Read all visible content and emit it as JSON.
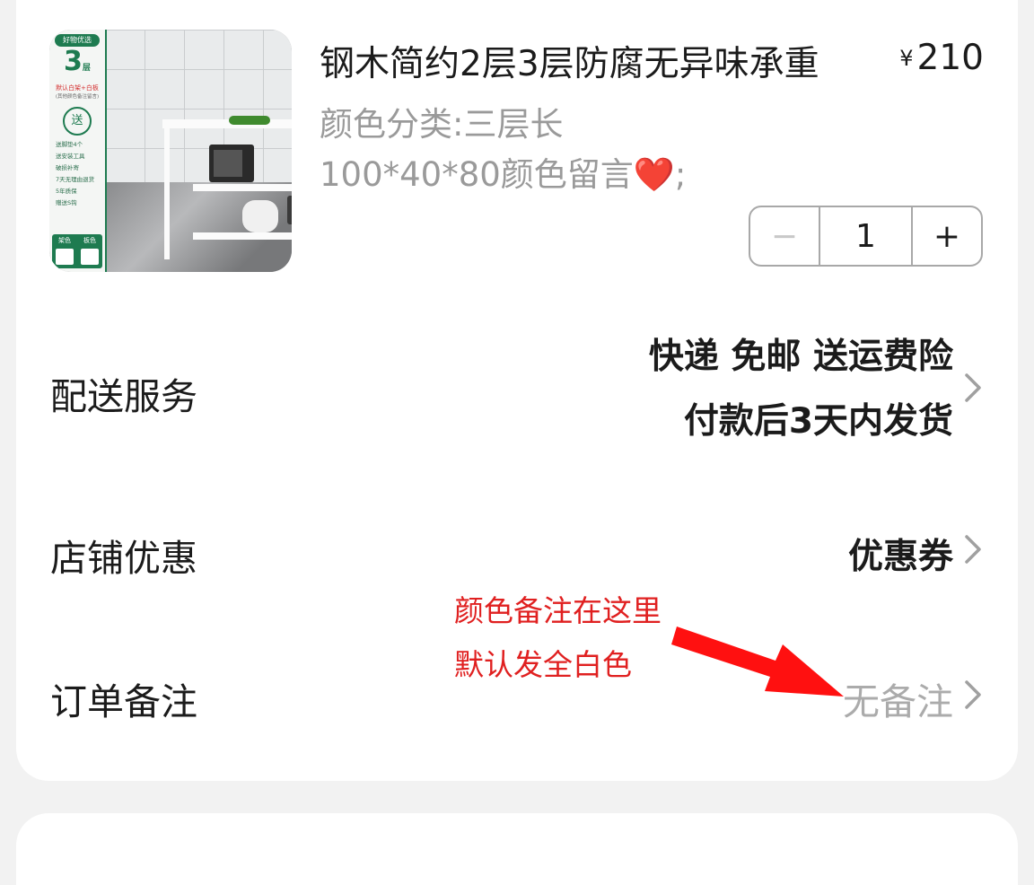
{
  "product": {
    "title": "钢木简约2层3层防腐无异味承重",
    "price_symbol": "¥",
    "price": "210",
    "spec_line1": "颜色分类:三层长",
    "spec_line2_text": "100*40*80颜色留言",
    "spec_line2_heart": "❤️",
    "spec_line2_end": ";",
    "thumbnail": {
      "badge": "好物优选",
      "layers_number": "3",
      "layers_unit": "层",
      "default_text": "默认白架+白板",
      "default_note": "(其他颜色备注留言)",
      "gift_label": "送",
      "features": [
        "送脚垫4个",
        "送安装工具",
        "破损补寄",
        "7天无理由退货",
        "5年质保",
        "赠送S钩"
      ],
      "swatch_labels": [
        "架色",
        "板色"
      ]
    }
  },
  "quantity": {
    "minus": "−",
    "value": "1",
    "plus": "+"
  },
  "delivery": {
    "label": "配送服务",
    "line1": "快递 免邮 送运费险",
    "line2": "付款后3天内发货"
  },
  "store_discount": {
    "label": "店铺优惠",
    "value": "优惠券"
  },
  "order_note": {
    "label": "订单备注",
    "value": "无备注"
  },
  "annotation": {
    "line1": "颜色备注在这里",
    "line2": "默认发全白色"
  },
  "colors": {
    "annotation_red": "#e02020",
    "brand_green": "#1e7b50",
    "muted_text": "#9a9a9a"
  }
}
